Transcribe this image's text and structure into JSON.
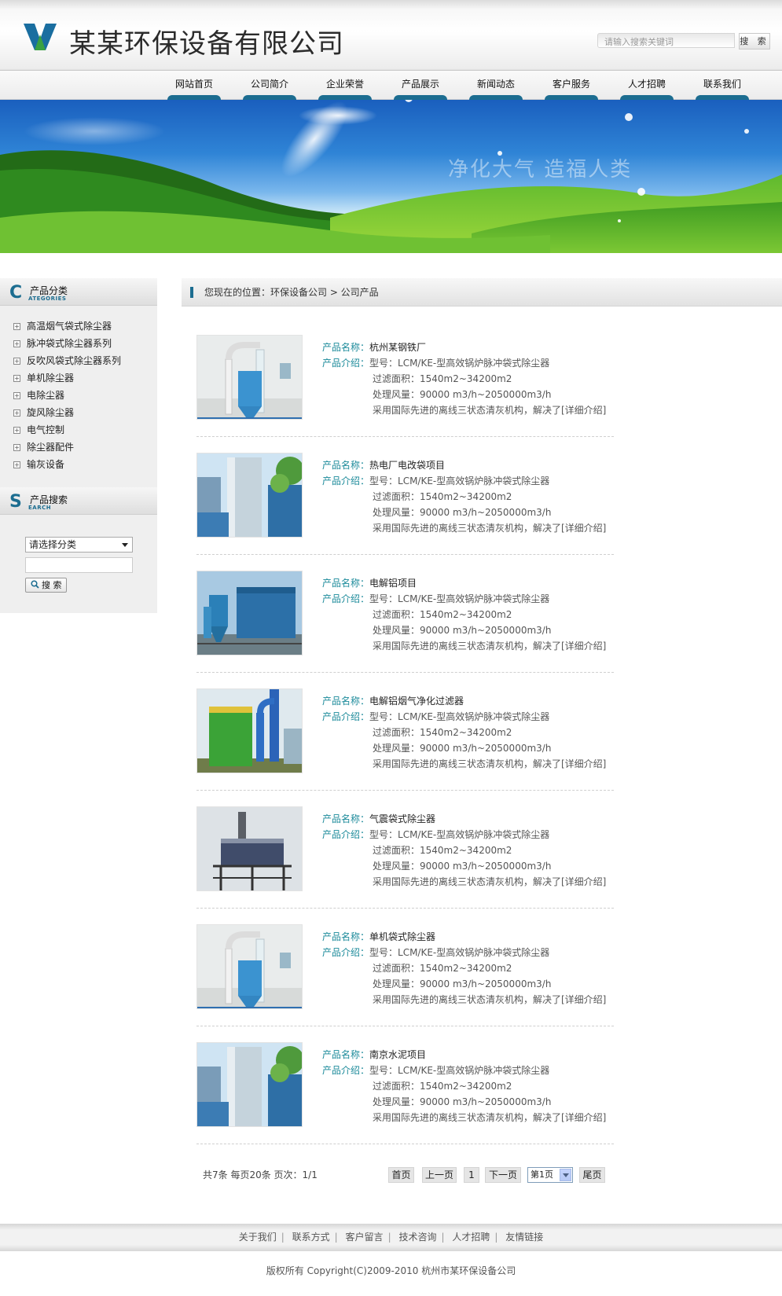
{
  "header": {
    "company_name": "某某环保设备有限公司",
    "search_placeholder": "请输入搜索关键词",
    "search_button": "搜 索"
  },
  "nav": {
    "items": [
      "网站首页",
      "公司简介",
      "企业荣誉",
      "产品展示",
      "新闻动态",
      "客户服务",
      "人才招聘",
      "联系我们"
    ]
  },
  "banner": {
    "slogan": "净化大气 造福人类"
  },
  "sidebar": {
    "category_title": "产品分类",
    "category_title_en": "ATEGORIES",
    "category_title_initial": "C",
    "categories": [
      "高温烟气袋式除尘器",
      "脉冲袋式除尘器系列",
      "反吹风袋式除尘器系列",
      "单机除尘器",
      "电除尘器",
      "旋风除尘器",
      "电气控制",
      "除尘器配件",
      "输灰设备"
    ],
    "search_title": "产品搜索",
    "search_title_en": "EARCH",
    "search_title_initial": "S",
    "select_placeholder": "请选择分类",
    "search_button": "搜 索"
  },
  "breadcrumb": {
    "text": "您现在的位置：环保设备公司 > 公司产品"
  },
  "products": {
    "name_label": "产品名称：",
    "intro_label": "产品介绍：",
    "model": "型号：LCM/KE-型高效锅炉脉冲袋式除尘器",
    "filter_area": "过滤面积：1540m2~34200m2",
    "air_volume": "处理风量：90000 m3/h~2050000m3/h",
    "summary": "采用国际先进的离线三状态清灰机构，解决了[详细介绍]",
    "items": [
      {
        "name": "杭州某钢铁厂",
        "image": "white-room-filter"
      },
      {
        "name": "热电厂电改袋项目",
        "image": "silo-tower"
      },
      {
        "name": "电解铝项目",
        "image": "blue-cyclone"
      },
      {
        "name": "电解铝烟气净化过滤器",
        "image": "green-filter"
      },
      {
        "name": "气震袋式除尘器",
        "image": "steel-frame"
      },
      {
        "name": "单机袋式除尘器",
        "image": "white-room-filter"
      },
      {
        "name": "南京水泥项目",
        "image": "silo-tower"
      }
    ]
  },
  "pager": {
    "info": "共7条  每页20条  页次：1/1",
    "first": "首页",
    "prev": "上一页",
    "current": "1",
    "next": "下一页",
    "select": "第1页",
    "last": "尾页"
  },
  "footer": {
    "links": [
      "关于我们",
      "联系方式",
      "客户留言",
      "技术咨询",
      "人才招聘",
      "友情链接"
    ],
    "copyright": "版权所有  Copyright(C)2009-2010 杭州市某环保设备公司"
  },
  "colors": {
    "accent": "#1c6d90",
    "label": "#1b8a9a",
    "logo_blue": "#1a6ea0",
    "logo_green": "#3aa142"
  }
}
